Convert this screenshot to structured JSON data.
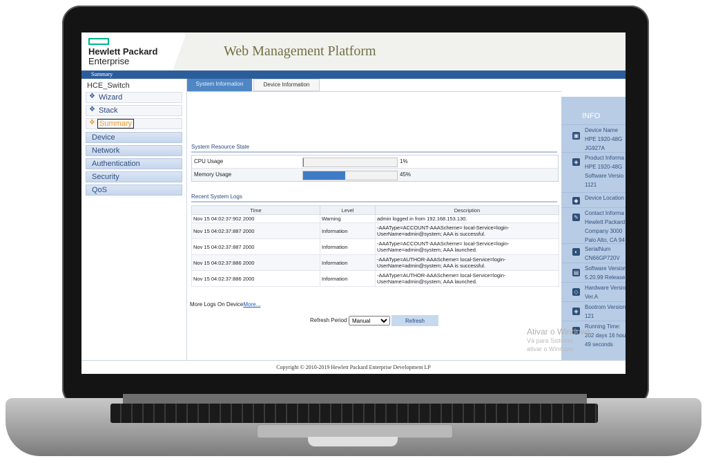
{
  "brand": {
    "line1": "Hewlett Packard",
    "line2": "Enterprise",
    "accent": "#00b388"
  },
  "header": {
    "title": "Web Management Platform"
  },
  "breadcrumb": "Summary",
  "sidebar": {
    "root": "HCE_Switch",
    "sub_items": [
      {
        "label": "Wizard"
      },
      {
        "label": "Stack"
      },
      {
        "label": "Summary",
        "active": true
      }
    ],
    "categories": [
      {
        "label": "Device"
      },
      {
        "label": "Network"
      },
      {
        "label": "Authentication"
      },
      {
        "label": "Security"
      },
      {
        "label": "QoS"
      }
    ]
  },
  "tabs": [
    {
      "label": "System Information",
      "active": true
    },
    {
      "label": "Device Information",
      "active": false
    }
  ],
  "resources": {
    "title": "System Resource State",
    "rows": [
      {
        "name": "CPU Usage",
        "percent": 1,
        "text": "1%"
      },
      {
        "name": "Memory Usage",
        "percent": 45,
        "text": "45%"
      }
    ]
  },
  "logs": {
    "title": "Recent System Logs",
    "columns": [
      "Time",
      "Level",
      "Description"
    ],
    "rows": [
      {
        "time": "Nov 15 04:02:37:902 2000",
        "level": "Warning",
        "desc": "admin logged in from 192.168.153.130."
      },
      {
        "time": "Nov 15 04:02:37:887 2000",
        "level": "Information",
        "desc": "-AAAType=ACCOUNT-AAAScheme= local-Service=login-UserName=admin@system; AAA is successful."
      },
      {
        "time": "Nov 15 04:02:37:887 2000",
        "level": "Information",
        "desc": "-AAAType=ACCOUNT-AAAScheme= local-Service=login-UserName=admin@system; AAA launched."
      },
      {
        "time": "Nov 15 04:02:37:886 2000",
        "level": "Information",
        "desc": "-AAAType=AUTHOR-AAAScheme= local-Service=login-UserName=admin@system; AAA is successful."
      },
      {
        "time": "Nov 15 04:02:37:886 2000",
        "level": "Information",
        "desc": "-AAAType=AUTHOR-AAAScheme= local-Service=login-UserName=admin@system; AAA launched."
      }
    ]
  },
  "more_logs": {
    "text": "More Logs On Device",
    "link": "More..."
  },
  "refresh": {
    "label": "Refresh Period",
    "selected": "Manual",
    "button": "Refresh"
  },
  "info": {
    "title": "INFO",
    "items": [
      {
        "icon": "device-name-icon",
        "lines": [
          "Device Name",
          "HPE 1920-48G",
          "JG927A"
        ]
      },
      {
        "icon": "product-info-icon",
        "lines": [
          "Product Informa",
          "HPE 1920-48G",
          "Software Versio",
          "1121"
        ]
      },
      {
        "icon": "device-location-icon",
        "lines": [
          "Device Location"
        ]
      },
      {
        "icon": "contact-info-icon",
        "lines": [
          "Contact Informa",
          "Hewlett Packard",
          "Company 3000",
          "Palo Alto, CA 94"
        ]
      },
      {
        "icon": "serial-number-icon",
        "lines": [
          "SerialNum",
          "CN66GP720V"
        ]
      },
      {
        "icon": "software-version-icon",
        "lines": [
          "Software Version",
          "5.20.99 Release"
        ]
      },
      {
        "icon": "hardware-version-icon",
        "lines": [
          "Hardware Versio",
          "Ver.A"
        ]
      },
      {
        "icon": "bootrom-version-icon",
        "lines": [
          "Bootrom Version",
          "121"
        ]
      },
      {
        "icon": "running-time-icon",
        "lines": [
          "Running Time:",
          "202 days 16 hou",
          "49 seconds"
        ]
      }
    ]
  },
  "watermark": {
    "line1": "Ativar o Windows",
    "line2": "Vá para Sistema",
    "line3": "ativar o Windows"
  },
  "footer": "Copyright © 2010-2019 Hewlett Packard Enterprise Development LP"
}
